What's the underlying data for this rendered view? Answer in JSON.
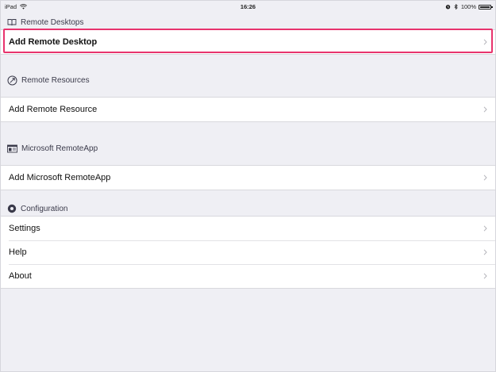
{
  "status_bar": {
    "device": "iPad",
    "time": "16:26",
    "battery": "100%",
    "icons": [
      "wifi-icon",
      "alarm-icon",
      "bluetooth-icon",
      "battery-icon"
    ]
  },
  "sections": [
    {
      "header": "Remote Desktops",
      "icon": "book-icon",
      "rows": [
        {
          "label": "Add Remote Desktop",
          "highlighted": true
        }
      ]
    },
    {
      "header": "Remote Resources",
      "icon": "remote-resource-icon",
      "rows": [
        {
          "label": "Add Remote Resource"
        }
      ]
    },
    {
      "header": "Microsoft RemoteApp",
      "icon": "remoteapp-icon",
      "rows": [
        {
          "label": "Add Microsoft RemoteApp"
        }
      ]
    },
    {
      "header": "Configuration",
      "icon": "configuration-icon",
      "rows": [
        {
          "label": "Settings"
        },
        {
          "label": "Help"
        },
        {
          "label": "About"
        }
      ]
    }
  ],
  "colors": {
    "background": "#efeff4",
    "highlight": "#e8336d"
  }
}
